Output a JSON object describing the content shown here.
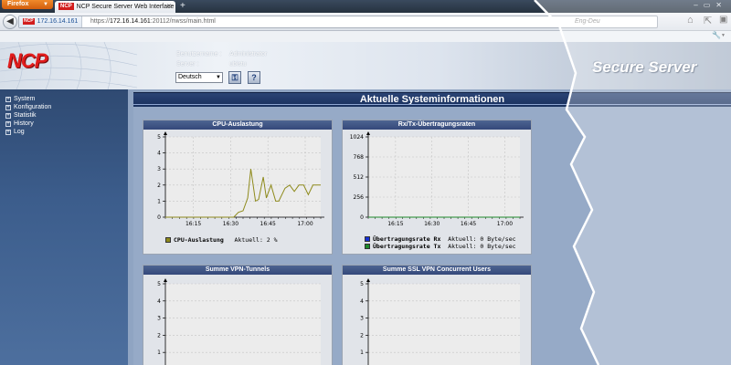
{
  "browser": {
    "menu_button": "Firefox",
    "tab_title": "NCP Secure Server Web Interface",
    "tab_logo": "NCP",
    "site_identity": "172.16.14.161",
    "url_prefix": "https://",
    "url_host": "172.16.14.161",
    "url_rest": ":20112/nwss/main.html",
    "url_right_text": "Eng-Deu",
    "icons": [
      "back-arrow-icon",
      "home-icon",
      "fullscreen-icon",
      "puzzle-icon",
      "wrench-icon"
    ]
  },
  "header": {
    "logo_text": "NCP",
    "username_label": "Benutzername :",
    "username_value": "Administrator",
    "server_label": "Server :",
    "server_value": "ubistu",
    "language_selected": "Deutsch",
    "brand_title": "Secure Server"
  },
  "sidebar": {
    "items": [
      {
        "label": "System"
      },
      {
        "label": "Konfiguration"
      },
      {
        "label": "Statistik"
      },
      {
        "label": "History"
      },
      {
        "label": "Log"
      }
    ]
  },
  "main": {
    "title": "Aktuelle Systeminformationen"
  },
  "panels": {
    "cpu": {
      "title": "CPU-Auslastung",
      "legend": [
        {
          "name": "CPU-Auslastung",
          "current": "Aktuell: 2 %",
          "color": "#8e8a1b"
        }
      ]
    },
    "rxtx": {
      "title": "Rx/Tx-Übertragungsraten",
      "legend": [
        {
          "name": "Übertragungsrate Rx",
          "current": "Aktuell: 0 Byte/sec",
          "color": "#1730d6"
        },
        {
          "name": "Übertragungsrate Tx",
          "current": "Aktuell: 0 Byte/sec",
          "color": "#1e8a2a"
        }
      ]
    },
    "vpn": {
      "title": "Summe VPN-Tunnels"
    },
    "ssl": {
      "title": "Summe SSL VPN Concurrent Users"
    }
  },
  "chart_data": [
    {
      "type": "line",
      "title": "CPU-Auslastung",
      "ylim": [
        0,
        5
      ],
      "yticks": [
        "0",
        "1",
        "2",
        "3",
        "4",
        "5"
      ],
      "xticks": [
        "16:15",
        "16:30",
        "16:45",
        "17:00"
      ],
      "series": [
        {
          "name": "CPU-Auslastung",
          "color": "#8e8a1b",
          "x": [
            0,
            0.06,
            0.13,
            0.2,
            0.27,
            0.34,
            0.41,
            0.44,
            0.47,
            0.5,
            0.53,
            0.55,
            0.58,
            0.6,
            0.63,
            0.65,
            0.68,
            0.71,
            0.73,
            0.77,
            0.8,
            0.83,
            0.86,
            0.89,
            0.92,
            0.95,
            1.0
          ],
          "values": [
            0,
            0,
            0,
            0,
            0,
            0,
            0,
            0,
            0.3,
            0.4,
            1.2,
            3.0,
            1.0,
            1.1,
            2.5,
            1.2,
            2.0,
            1.0,
            1.0,
            1.8,
            2.0,
            1.6,
            2.0,
            2.0,
            1.4,
            2.0,
            2.0
          ]
        }
      ]
    },
    {
      "type": "line",
      "title": "Rx/Tx-Übertragungsraten",
      "ylim": [
        0,
        1024
      ],
      "yticks": [
        "0",
        "256",
        "512",
        "768",
        "1024"
      ],
      "xticks": [
        "16:15",
        "16:30",
        "16:45",
        "17:00"
      ],
      "series": [
        {
          "name": "Übertragungsrate Rx",
          "color": "#1730d6",
          "values": [
            0,
            0
          ]
        },
        {
          "name": "Übertragungsrate Tx",
          "color": "#1e8a2a",
          "values": [
            0,
            0
          ]
        }
      ]
    },
    {
      "type": "line",
      "title": "Summe VPN-Tunnels",
      "ylim": [
        0,
        5
      ],
      "yticks": [
        "1",
        "2",
        "3",
        "4",
        "5"
      ],
      "series": []
    },
    {
      "type": "line",
      "title": "Summe SSL VPN Concurrent Users",
      "ylim": [
        0,
        5
      ],
      "yticks": [
        "1",
        "2",
        "3",
        "4",
        "5"
      ],
      "series": []
    }
  ]
}
